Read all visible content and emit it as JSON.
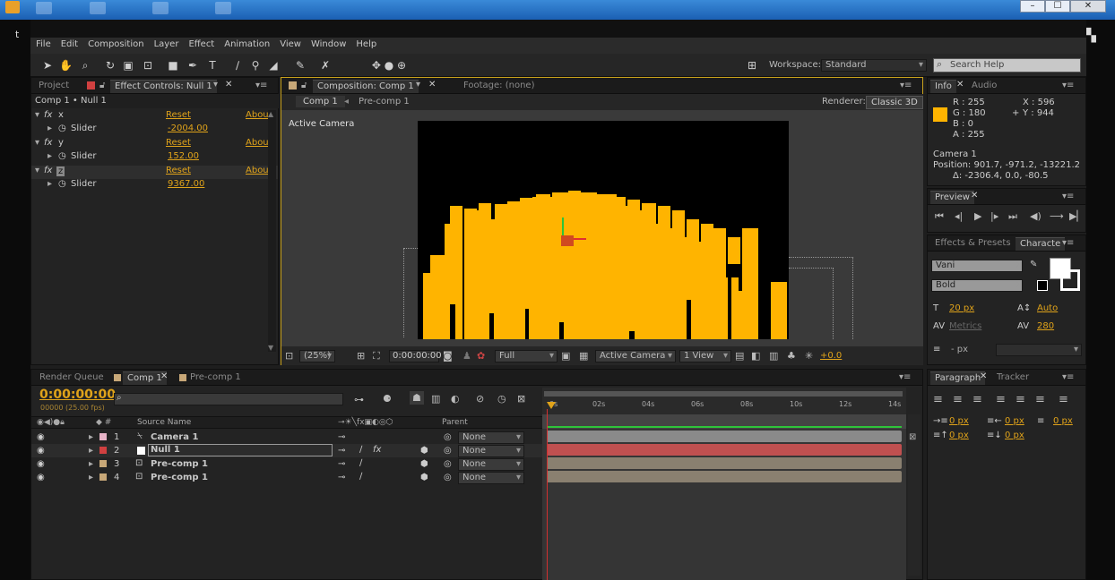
{
  "window": {
    "controls": [
      "–",
      "☐",
      "✕"
    ]
  },
  "app_title_letter": "t",
  "menu": [
    "File",
    "Edit",
    "Composition",
    "Layer",
    "Effect",
    "Animation",
    "View",
    "Window",
    "Help"
  ],
  "toolbar": {
    "workspace_label": "Workspace:",
    "workspace_value": "Standard",
    "search_placeholder": "Search Help"
  },
  "effect_controls": {
    "tabs": {
      "project": "Project",
      "effect_controls": "Effect Controls: Null 1"
    },
    "header": "Comp 1 • Null 1",
    "effects": [
      {
        "name": "x",
        "reset": "Reset",
        "about": "Abou",
        "param": "Slider",
        "value": "-2004.00"
      },
      {
        "name": "y",
        "reset": "Reset",
        "about": "Abou",
        "param": "Slider",
        "value": "152.00"
      },
      {
        "name": "z",
        "reset": "Reset",
        "about": "Abou",
        "param": "Slider",
        "value": "9367.00"
      }
    ]
  },
  "composition": {
    "tab": "Composition: Comp 1",
    "footage_tab": "Footage: (none)",
    "breadcrumbs": [
      "Comp 1",
      "Pre-comp 1"
    ],
    "renderer_label": "Renderer:",
    "renderer_value": "Classic 3D",
    "camera_label": "Active Camera",
    "bottom": {
      "zoom": "(25%)",
      "timecode": "0:00:00:00",
      "resolution": "Full",
      "camera": "Active Camera",
      "view": "1 View",
      "exposure": "+0.0"
    },
    "accent_color": "#ffb400"
  },
  "timeline": {
    "tabs": [
      "Render Queue",
      "Comp 1",
      "Pre-comp 1"
    ],
    "timecode": "0:00:00:00",
    "fps": "00000 (25.00 fps)",
    "search_placeholder": "",
    "col_source": "Source Name",
    "col_parent": "Parent",
    "ruler": [
      "0s",
      "02s",
      "04s",
      "06s",
      "08s",
      "10s",
      "12s",
      "14s"
    ],
    "layers": [
      {
        "num": "1",
        "name": "Camera 1",
        "parent": "None",
        "color": "#e8b4c8",
        "track": "#8a8a8a"
      },
      {
        "num": "2",
        "name": "Null 1",
        "parent": "None",
        "color": "#d04040",
        "track": "#c05050"
      },
      {
        "num": "3",
        "name": "Pre-comp 1",
        "parent": "None",
        "color": "#c8a878",
        "track": "#8a8070"
      },
      {
        "num": "4",
        "name": "Pre-comp 1",
        "parent": "None",
        "color": "#c8a878",
        "track": "#8a8070"
      }
    ]
  },
  "info": {
    "tabs": [
      "Info",
      "Audio"
    ],
    "r": "R : 255",
    "g": "G : 180",
    "b": "B : 0",
    "a": "A : 255",
    "x": "X : 596",
    "y": "Y : 944",
    "swatch_color": "#ffb400",
    "line1": "Camera 1",
    "line2": "Position: 901.7, -971.2, -13221.2",
    "line3": "Δ: -2306.4, 0.0, -80.5"
  },
  "preview": {
    "tab": "Preview"
  },
  "character": {
    "tabs": [
      "Effects & Presets",
      "Characte"
    ],
    "font": "Vani",
    "style": "Bold",
    "size": "20 px",
    "leading": "Auto",
    "kerning": "Metrics",
    "tracking": "280",
    "stroke": "- px"
  },
  "paragraph": {
    "tabs": [
      "Paragraph",
      "Tracker"
    ],
    "indent_left": "0 px",
    "indent_right": "0 px",
    "indent_first": "0 px",
    "space_before": "0 px",
    "space_after": "0 px"
  }
}
